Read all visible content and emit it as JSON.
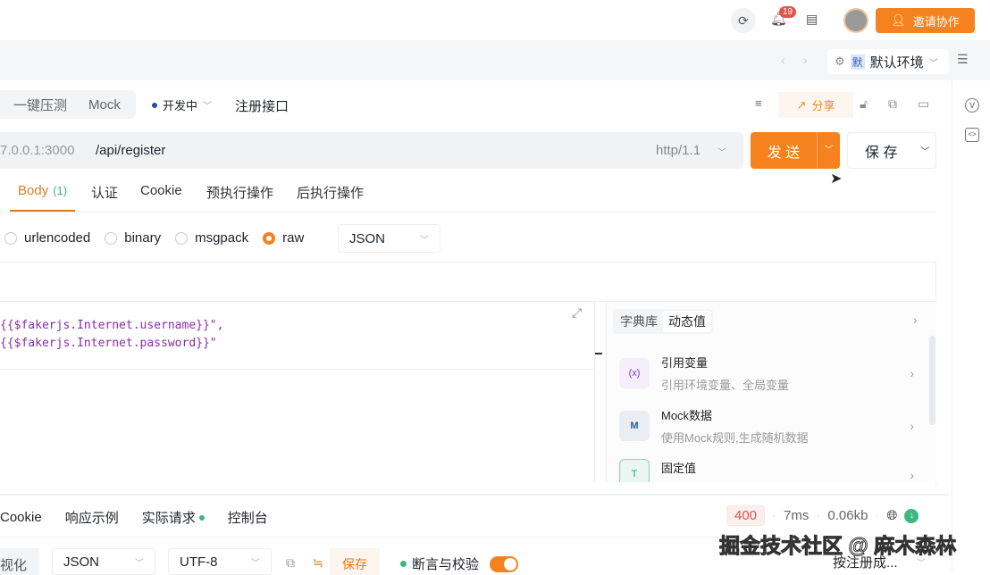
{
  "topbar": {
    "notification_count": "19",
    "invite_label": "邀请协作"
  },
  "env": {
    "badge": "默",
    "name": "默认环境"
  },
  "request": {
    "seg_items": [
      "一键压测",
      "Mock"
    ],
    "status": "开发中",
    "name": "注册接口",
    "share_label": "分享",
    "host": "7.0.0.1:3000",
    "path": "/api/register",
    "protocol": "http/1.1",
    "send_label": "发 送",
    "save_label": "保 存"
  },
  "tabs": [
    {
      "label": "Body",
      "count": "(1)"
    },
    {
      "label": "认证"
    },
    {
      "label": "Cookie"
    },
    {
      "label": "预执行操作"
    },
    {
      "label": "后执行操作"
    }
  ],
  "body_types": [
    "urlencoded",
    "binary",
    "msgpack",
    "raw"
  ],
  "body_format": "JSON",
  "code_lines": [
    "{{$fakerjs.Internet.username}}\",",
    "{{$fakerjs.Internet.password}}\""
  ],
  "panel": {
    "tabs": [
      "字典库",
      "动态值"
    ],
    "items": [
      {
        "icon": "(x)",
        "title": "引用变量",
        "sub": "引用环境变量、全局变量"
      },
      {
        "icon": "M",
        "title": "Mock数据",
        "sub": "使用Mock规则,生成随机数据"
      },
      {
        "icon": "T",
        "title": "固定值",
        "sub": ""
      }
    ]
  },
  "response": {
    "tabs": [
      "Cookie",
      "响应示例",
      "实际请求",
      "控制台"
    ],
    "status_code": "400",
    "time": "7ms",
    "size": "0.06kb",
    "view_label": "视化",
    "format": "JSON",
    "encoding": "UTF-8",
    "save_label": "保存",
    "assert_label": "断言与校验",
    "sort_label": "按注册成..."
  },
  "watermark": "掘金技术社区 @ 麻木森林"
}
